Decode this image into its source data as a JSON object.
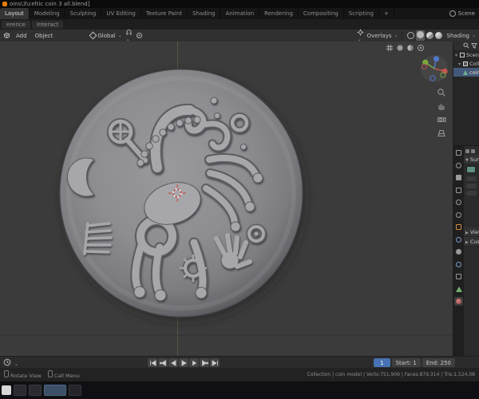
{
  "window": {
    "title": "oins\\3\\celtic coin 3 all.blend]"
  },
  "topbar": {
    "tabs": [
      "Layout",
      "Modeling",
      "Sculpting",
      "UV Editing",
      "Texture Paint",
      "Shading",
      "Animation",
      "Rendering",
      "Compositing",
      "Scripting",
      "+"
    ],
    "active_tab": "Layout",
    "scene_label": "Scene"
  },
  "subtabs": {
    "left": "erence",
    "right": "Interact"
  },
  "header": {
    "add": "Add",
    "object": "Object",
    "orientation": "Global",
    "overlays": "Overlays",
    "shading": "Shading"
  },
  "outliner": {
    "items": [
      {
        "label": "Scene Collection"
      },
      {
        "label": "Collection"
      },
      {
        "label": "coin model"
      }
    ]
  },
  "properties": {
    "panels": {
      "surface": "Surface",
      "viewport": "Viewport Display",
      "custom": "Custom Properties"
    },
    "surface_color": "#5f8f82"
  },
  "timeline": {
    "current": "1",
    "start": "Start: 1",
    "end": "End: 250"
  },
  "statusbar": {
    "hint1": "Rotate View",
    "hint2": "Call Menu",
    "stats": "Collection | coin model | Verts:751,906 | Faces:879,314 | Tris:1,524,08"
  },
  "colors": {
    "accent": "#4772b3",
    "viewport_bg": "#3b3b3b",
    "axis_x": "#c4554d",
    "axis_y": "#79a93f",
    "axis_z": "#5077c9"
  }
}
